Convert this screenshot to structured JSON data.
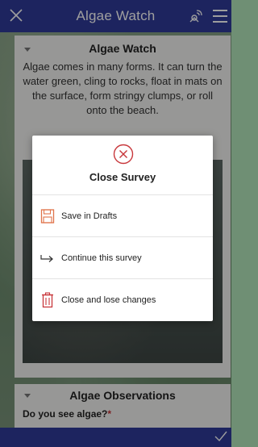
{
  "topbar": {
    "title": "Algae Watch",
    "icons": [
      "close-icon",
      "gps-icon",
      "menu-icon"
    ]
  },
  "section1": {
    "title": "Algae Watch",
    "description": "Algae comes in many forms. It can turn the water green, cling to rocks, float in mats on the surface, form stringy clumps, or roll onto the beach."
  },
  "section2": {
    "title": "Algae Observations",
    "question": "Do you see algae?",
    "required_mark": "*"
  },
  "dialog": {
    "title": "Close Survey",
    "options": [
      {
        "label": "Save in Drafts",
        "icon": "save-icon"
      },
      {
        "label": "Continue this survey",
        "icon": "arrow-right-icon"
      },
      {
        "label": "Close and lose changes",
        "icon": "trash-icon"
      }
    ]
  },
  "colors": {
    "bar": "#2f3a9a",
    "accent": "#e0734a",
    "danger": "#c8373b"
  }
}
